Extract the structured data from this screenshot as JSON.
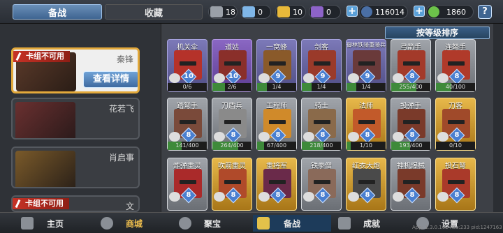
{
  "top": {
    "tab_prepare": "备战",
    "tab_collection": "收藏",
    "res1": "18",
    "res2": "0",
    "res3": "10",
    "res4": "0",
    "gold": "116014",
    "gems": "1860",
    "help": "?"
  },
  "sort_label": "按等级排序",
  "generals": [
    {
      "name": "秦锋",
      "unavailable": "卡组不可用",
      "detail": "查看详情"
    },
    {
      "name": "花若飞"
    },
    {
      "name": "肖启事"
    },
    {
      "name": "文",
      "unavailable": "卡组不可用"
    }
  ],
  "cards": [
    {
      "name": "机关伞",
      "level": "10",
      "progress": "0/6"
    },
    {
      "name": "道姑",
      "level": "10",
      "progress": "2/6"
    },
    {
      "name": "一窝蜂",
      "level": "9",
      "progress": "1/4"
    },
    {
      "name": "剑客",
      "level": "9",
      "progress": "1/4"
    },
    {
      "name": "御林铁骑重骑兵",
      "level": "9",
      "progress": "1/4"
    },
    {
      "name": "弓箭手",
      "level": "8",
      "progress": "255/400"
    },
    {
      "name": "连弩手",
      "level": "8",
      "progress": "40/100"
    },
    {
      "name": "踏弩手",
      "level": "8",
      "progress": "141/400"
    },
    {
      "name": "刀盾兵",
      "level": "8",
      "progress": "264/400"
    },
    {
      "name": "工程师",
      "level": "8",
      "progress": "67/400"
    },
    {
      "name": "骑士",
      "level": "8",
      "progress": "218/400"
    },
    {
      "name": "法师",
      "level": "8",
      "progress": "1/10"
    },
    {
      "name": "投弹手",
      "level": "8",
      "progress": "193/400"
    },
    {
      "name": "刀客",
      "level": "8",
      "progress": "0/10"
    },
    {
      "name": "炸弹重灵",
      "level": "8",
      "progress": ""
    },
    {
      "name": "吹箭重灵",
      "level": "8",
      "progress": ""
    },
    {
      "name": "重将军",
      "level": "8",
      "progress": ""
    },
    {
      "name": "铁拳僧",
      "level": "8",
      "progress": ""
    },
    {
      "name": "红衣大炮",
      "level": "8",
      "progress": ""
    },
    {
      "name": "神机爆械",
      "level": "8",
      "progress": ""
    },
    {
      "name": "投石弩",
      "level": "8",
      "progress": ""
    }
  ],
  "nav": {
    "home": "主页",
    "shop": "商城",
    "treasure": "聚宝",
    "prepare": "备战",
    "achieve": "成就",
    "settings": "设置"
  },
  "version": "App: 1.3.0.162 Res:233 pid:1247163"
}
